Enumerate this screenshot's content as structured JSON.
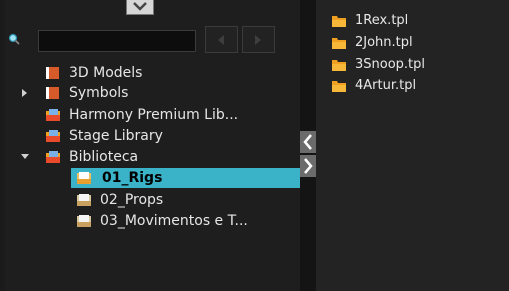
{
  "tree": {
    "items": [
      {
        "label": "3D Models",
        "icon": "library-icon"
      },
      {
        "label": "Symbols",
        "icon": "library-icon"
      },
      {
        "label": "Harmony Premium Lib...",
        "icon": "library-folder-icon"
      },
      {
        "label": "Stage Library",
        "icon": "library-folder-icon"
      },
      {
        "label": "Biblioteca",
        "icon": "library-folder-icon"
      },
      {
        "label": "01_Rigs",
        "icon": "library-folder-icon"
      },
      {
        "label": "02_Props",
        "icon": "library-folder-icon"
      },
      {
        "label": "03_Movimentos e T...",
        "icon": "library-folder-icon"
      }
    ],
    "selected_label": "01_Rigs"
  },
  "files": {
    "items": [
      {
        "name": "1Rex.tpl",
        "icon": "template-folder-icon"
      },
      {
        "name": "2John.tpl",
        "icon": "template-folder-icon"
      },
      {
        "name": "3Snoop.tpl",
        "icon": "template-folder-icon"
      },
      {
        "name": "4Artur.tpl",
        "icon": "template-folder-icon"
      }
    ]
  },
  "colors": {
    "selection": "#3ab2c8",
    "folder": "#f0a020",
    "library_red": "#d65a2a"
  }
}
